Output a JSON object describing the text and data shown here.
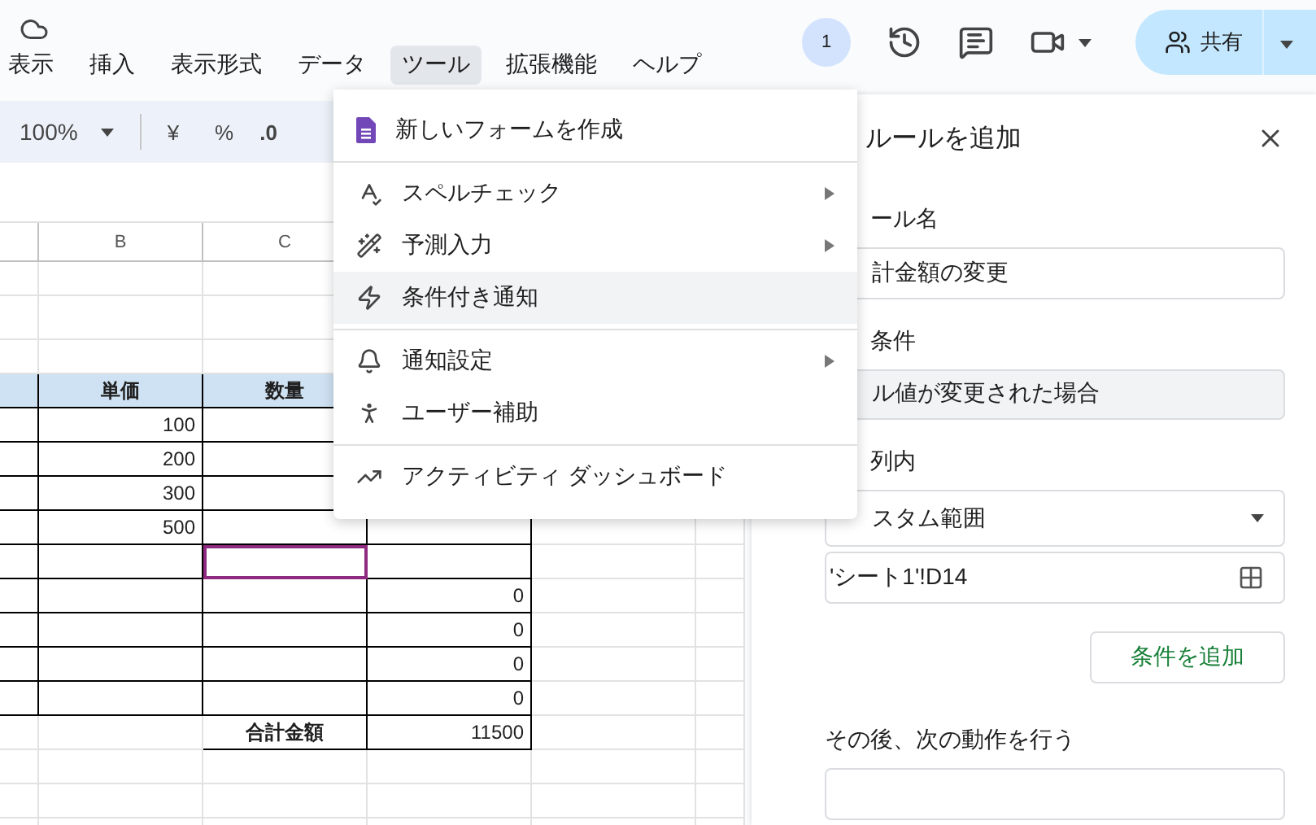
{
  "header": {
    "menus": [
      {
        "label": "表示",
        "selected": false
      },
      {
        "label": "挿入",
        "selected": false
      },
      {
        "label": "表示形式",
        "selected": false
      },
      {
        "label": "データ",
        "selected": false
      },
      {
        "label": "ツール",
        "selected": true
      },
      {
        "label": "拡張機能",
        "selected": false
      },
      {
        "label": "ヘルプ",
        "selected": false
      }
    ],
    "presence": "1",
    "share": "共有"
  },
  "toolbar": {
    "zoom": "100%",
    "currency": "¥",
    "percent": "%",
    "decimal": ".0"
  },
  "sheet": {
    "column_headers": {
      "B": "B",
      "C": "C"
    },
    "rows": [
      {
        "kind": "blank"
      },
      {
        "kind": "blank"
      },
      {
        "kind": "blank"
      },
      {
        "kind": "header",
        "cells": {
          "B": {
            "text": "単価"
          },
          "C": {
            "text": "数量"
          }
        }
      },
      {
        "kind": "table",
        "cells": {
          "B": {
            "text": "100"
          }
        }
      },
      {
        "kind": "table",
        "cells": {
          "B": {
            "text": "200"
          }
        }
      },
      {
        "kind": "table",
        "cells": {
          "B": {
            "text": "300"
          }
        }
      },
      {
        "kind": "table",
        "cells": {
          "B": {
            "text": "500"
          }
        }
      },
      {
        "kind": "table",
        "cells": {
          "C": {
            "active": true
          }
        }
      },
      {
        "kind": "table",
        "cells": {
          "D": {
            "text": "0"
          }
        }
      },
      {
        "kind": "table",
        "cells": {
          "D": {
            "text": "0"
          }
        }
      },
      {
        "kind": "table",
        "cells": {
          "D": {
            "text": "0"
          }
        }
      },
      {
        "kind": "table",
        "cells": {
          "D": {
            "text": "0"
          }
        }
      },
      {
        "kind": "total",
        "cells": {
          "C": {
            "text": "合計金額"
          },
          "D": {
            "text": "11500"
          }
        }
      },
      {
        "kind": "blank"
      },
      {
        "kind": "blank"
      },
      {
        "kind": "blank"
      }
    ]
  },
  "menu": {
    "groups": [
      [
        {
          "label": "新しいフォームを作成",
          "submenu": false,
          "highlighted": false
        }
      ],
      [
        {
          "label": "スペルチェック",
          "submenu": true,
          "highlighted": false
        },
        {
          "label": "予測入力",
          "submenu": true,
          "highlighted": false
        },
        {
          "label": "条件付き通知",
          "submenu": false,
          "highlighted": true
        }
      ],
      [
        {
          "label": "通知設定",
          "submenu": true,
          "highlighted": false
        },
        {
          "label": "ユーザー補助",
          "submenu": false,
          "highlighted": false
        }
      ],
      [
        {
          "label": "アクティビティ ダッシュボード",
          "submenu": false,
          "highlighted": false
        }
      ]
    ]
  },
  "panel": {
    "title": "ルールを追加",
    "sections": [
      {
        "kind": "text",
        "label": "ール名",
        "value": "計金額の変更"
      },
      {
        "kind": "readonly",
        "label": "条件",
        "value": "ル値が変更された場合"
      },
      {
        "kind": "select",
        "label": "列内",
        "value": "スタム範囲",
        "range": "'シート1'!D14"
      }
    ],
    "add_condition": "条件を追加",
    "next_label": "その後、次の動作を行う"
  }
}
